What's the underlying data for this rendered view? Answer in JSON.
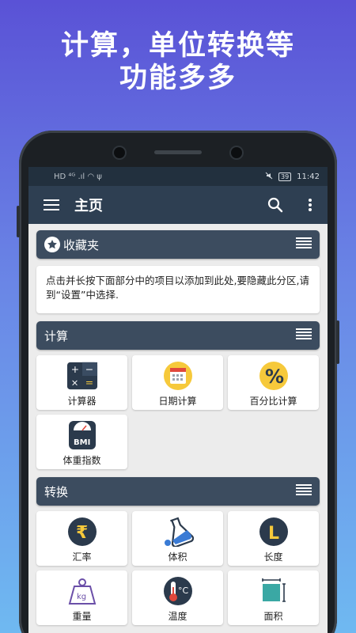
{
  "promo": {
    "line1": "计算，单位转换等",
    "line2": "功能多多"
  },
  "statusbar": {
    "left_icons": "HD ⁴ᴳ .ıl ◠ ψ",
    "battery": "39",
    "time": "11:42"
  },
  "appbar": {
    "title": "主页",
    "menu_icon": "hamburger-menu-icon",
    "search_icon": "search-icon",
    "more_icon": "more-vert-icon"
  },
  "favorites": {
    "header": "收藏夹",
    "note": "点击并长按下面部分中的项目以添加到此处,要隐藏此分区,请到“设置”中选择."
  },
  "calculate": {
    "header": "计算",
    "items": [
      {
        "label": "计算器",
        "icon": "calculator-icon"
      },
      {
        "label": "日期计算",
        "icon": "calendar-icon"
      },
      {
        "label": "百分比计算",
        "icon": "percent-icon"
      },
      {
        "label": "体重指数",
        "icon": "bmi-scale-icon",
        "icon_text": "BMI"
      }
    ]
  },
  "convert": {
    "header": "转换",
    "items": [
      {
        "label": "汇率",
        "icon": "rupee-icon",
        "icon_text": "₹"
      },
      {
        "label": "体积",
        "icon": "flask-icon"
      },
      {
        "label": "长度",
        "icon": "length-icon",
        "icon_text": "L"
      },
      {
        "label": "重量",
        "icon": "weight-icon",
        "icon_text": "kg"
      },
      {
        "label": "温度",
        "icon": "thermometer-icon",
        "icon_text": "°C"
      },
      {
        "label": "面积",
        "icon": "area-icon"
      }
    ]
  },
  "colors": {
    "appbar": "#2e3f52",
    "section": "#3c4c5f",
    "accent_yellow": "#f6c93b"
  }
}
